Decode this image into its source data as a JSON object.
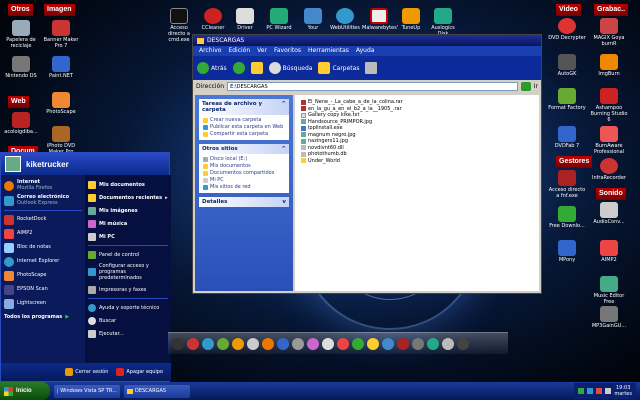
{
  "desktop": {
    "groups": [
      {
        "label": "Otros"
      },
      {
        "label": "Imagen"
      },
      {
        "label": "Web"
      },
      {
        "label": "Docum"
      },
      {
        "label": "Video"
      },
      {
        "label": "Grabac.."
      },
      {
        "label": "Gestores"
      },
      {
        "label": "Sonido"
      }
    ],
    "left_icons": [
      {
        "label": "Papelera de reciclaje"
      },
      {
        "label": "Banner Maker Pro 7"
      },
      {
        "label": "Nintendo DS"
      },
      {
        "label": "Paint.NET"
      },
      {
        "label": "PhotoScape"
      },
      {
        "label": "acoloigdiba..."
      },
      {
        "label": "iPhoto DVD Maker Pro"
      }
    ],
    "top_icons": [
      {
        "label": "Acceso directo a cmd.exe"
      },
      {
        "label": "CCleaner"
      },
      {
        "label": "Driver"
      },
      {
        "label": "PC Wizard"
      },
      {
        "label": "Your"
      },
      {
        "label": "WebUtilities"
      },
      {
        "label": "Malwarebytes'"
      },
      {
        "label": "TuneUp"
      },
      {
        "label": "Auslogics Disk"
      }
    ],
    "right_icons": [
      {
        "label": "DVD Decrypter"
      },
      {
        "label": "MAGIX Goya burnR"
      },
      {
        "label": "AutoGK"
      },
      {
        "label": "ImgBurn"
      },
      {
        "label": "Format Factory"
      },
      {
        "label": "Ashampoo Burning Studio 6"
      },
      {
        "label": "DVDFab 7"
      },
      {
        "label": "BurnAware Professional"
      },
      {
        "label": "InfraRecorder"
      },
      {
        "label": "Acceso directo a fnf.exe"
      },
      {
        "label": "Free Downlo..."
      },
      {
        "label": "AudioConv..."
      },
      {
        "label": "MPony"
      },
      {
        "label": "AIMP2"
      },
      {
        "label": "Music Editor Free"
      },
      {
        "label": "MP3GainGU..."
      }
    ]
  },
  "explorer": {
    "title": "DESCARGAS",
    "menu": [
      "Archivo",
      "Edición",
      "Ver",
      "Favoritos",
      "Herramientas",
      "Ayuda"
    ],
    "back_label": "Atrás",
    "search_label": "Búsqueda",
    "folders_label": "Carpetas",
    "address_label": "Dirección",
    "address_value": "E:\\DESCARGAS",
    "go_label": "Ir",
    "tasks_title": "Tareas de archivo y carpeta",
    "tasks": [
      "Crear nueva carpeta",
      "Publicar esta carpeta en Web",
      "Compartir esta carpeta"
    ],
    "places_title": "Otros sitios",
    "places": [
      "Disco local (E:)",
      "Mis documentos",
      "Documentos compartidos",
      "Mi PC",
      "Mis sitios de red"
    ],
    "details_title": "Detalles",
    "files": [
      "El_Nene_-_La_cabe_a_de_la_colina.rar",
      "en_la_gu_a_en_el_b2_a_la__1905_.rar",
      "Gallery copy kike.txt",
      "Handsource_PRIMPOR.jpg",
      "lpplinstall.exe",
      "magnum negro.jpg",
      "nazingers11.jpg",
      "novdivnt60.dll",
      "photothumb.db",
      "Under_World"
    ]
  },
  "start_menu": {
    "user": "kiketrucker",
    "pinned": [
      {
        "title": "Internet",
        "sub": "Mozilla Firefox"
      },
      {
        "title": "Correo electrónico",
        "sub": "Outlook Express"
      }
    ],
    "recent": [
      "RocketDock",
      "AIMP2",
      "Bloc de notas",
      "Internet Explorer",
      "PhotoScape",
      "EPSON Scan",
      "Lightscreen"
    ],
    "all_programs": "Todos los programas",
    "right": [
      {
        "label": "Mis documentos",
        "bold": true
      },
      {
        "label": "Documentos recientes",
        "bold": true
      },
      {
        "label": "Mis imágenes",
        "bold": true
      },
      {
        "label": "Mi música",
        "bold": true
      },
      {
        "label": "Mi PC",
        "bold": true
      },
      {
        "label": "Panel de control"
      },
      {
        "label": "Configurar acceso y programas predeterminados"
      },
      {
        "label": "Impresoras y faxes"
      },
      {
        "label": "Ayuda y soporte técnico"
      },
      {
        "label": "Buscar"
      },
      {
        "label": "Ejecutar..."
      }
    ],
    "logoff": "Cerrar sesión",
    "shutdown": "Apagar equipo"
  },
  "taskbar": {
    "start_label": "Inicio",
    "tasks": [
      "Windows Vista SP TR...",
      "DESCARGAS"
    ],
    "time": "19:03",
    "day": "martes"
  }
}
